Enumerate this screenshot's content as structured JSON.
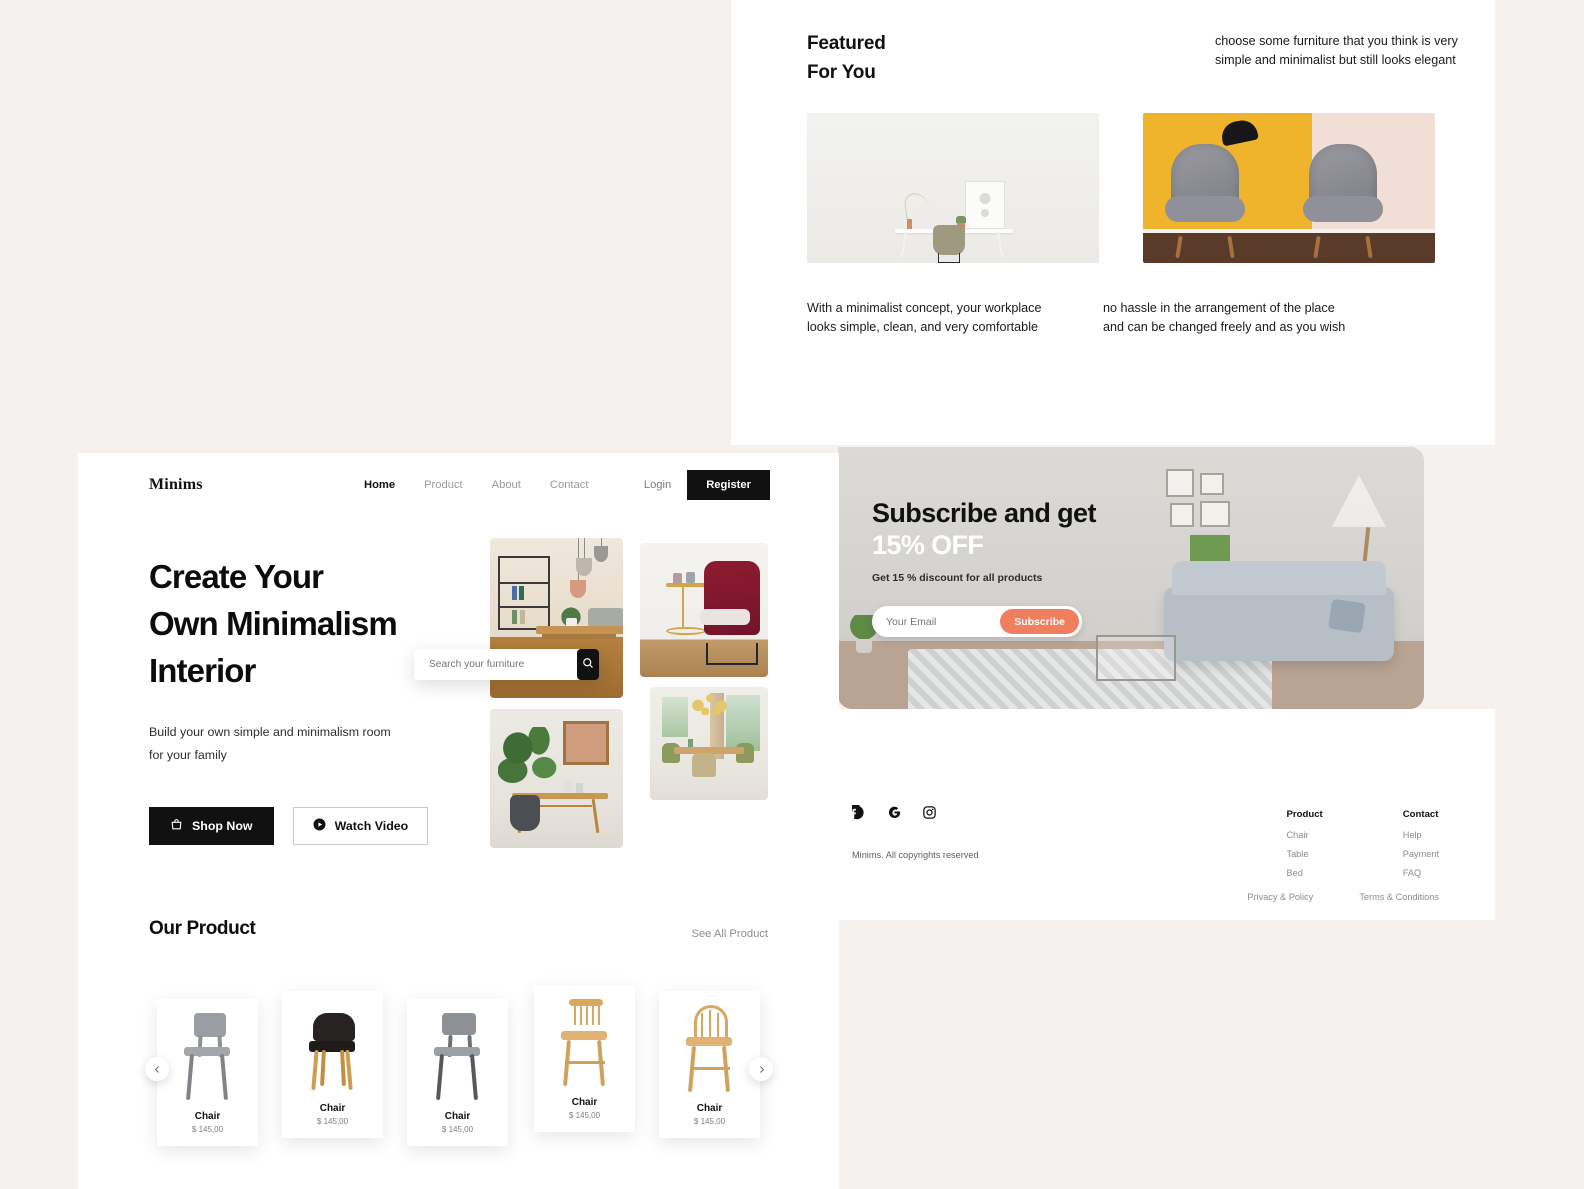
{
  "theme": {
    "page_bg": "#f4f1ef",
    "accent": "#ef7f5e",
    "dark": "#111111"
  },
  "featured": {
    "title_line1": "Featured",
    "title_line2": "For You",
    "description": "choose some furniture that you think is very simple and minimalist but still looks elegant",
    "cards": [
      {
        "caption": "With a minimalist concept, your workplace looks simple, clean, and very comfortable",
        "image_alt": "white-desk-and-chair"
      },
      {
        "caption": "no hassle in the arrangement of the place and can be changed freely and as you wish",
        "image_alt": "grey-armchairs-yellow-wall"
      }
    ]
  },
  "subscribe": {
    "heading_dark": "Subscribe and get",
    "heading_light": "15% OFF",
    "subtext": "Get 15 % discount for all products",
    "email_placeholder": "Your Email",
    "email_value": "",
    "button_label": "Subscribe"
  },
  "footer": {
    "copyright": "Minims. All copyrights reserved",
    "social": [
      {
        "name": "facebook-icon"
      },
      {
        "name": "google-icon"
      },
      {
        "name": "instagram-icon"
      }
    ],
    "columns": [
      {
        "heading": "Product",
        "links": [
          "Chair",
          "Table",
          "Bed"
        ]
      },
      {
        "heading": "Contact",
        "links": [
          "Help",
          "Payment",
          "FAQ"
        ]
      }
    ],
    "legal": [
      "Privacy & Policy",
      "Terms & Conditions"
    ]
  },
  "nav": {
    "brand": "Minims",
    "links": [
      {
        "label": "Home",
        "active": true
      },
      {
        "label": "Product",
        "active": false
      },
      {
        "label": "About",
        "active": false
      },
      {
        "label": "Contact",
        "active": false
      }
    ],
    "login_label": "Login",
    "register_label": "Register"
  },
  "hero": {
    "heading_line1": "Create Your",
    "heading_line2": "Own Minimalism",
    "heading_line3": "Interior",
    "paragraph": "Build your own simple and minimalism room for your family",
    "shop_label": "Shop Now",
    "watch_label": "Watch Video",
    "shop_icon": "bag-icon",
    "watch_icon": "play-circle-icon",
    "search_placeholder": "Search your furniture",
    "search_value": "",
    "search_icon": "search-icon",
    "images": [
      {
        "alt": "dining-room-with-shelves-and-pendant-lamps"
      },
      {
        "alt": "red-armchair-with-side-table"
      },
      {
        "alt": "plant-and-wooden-console-table"
      },
      {
        "alt": "dining-table-with-chandelier"
      }
    ]
  },
  "products": {
    "section_title": "Our Product",
    "see_all_label": "See All Product",
    "prev_icon": "chevron-left-icon",
    "next_icon": "chevron-right-icon",
    "items": [
      {
        "name": "Chair",
        "price": "$ 145,00",
        "style": "grey-modern"
      },
      {
        "name": "Chair",
        "price": "$ 145,00",
        "style": "black-wood-armchair"
      },
      {
        "name": "Chair",
        "price": "$ 145,00",
        "style": "grey-slim"
      },
      {
        "name": "Chair",
        "price": "$ 145,00",
        "style": "wood-slat-back"
      },
      {
        "name": "Chair",
        "price": "$ 145,00",
        "style": "wood-hoop-back"
      }
    ]
  }
}
